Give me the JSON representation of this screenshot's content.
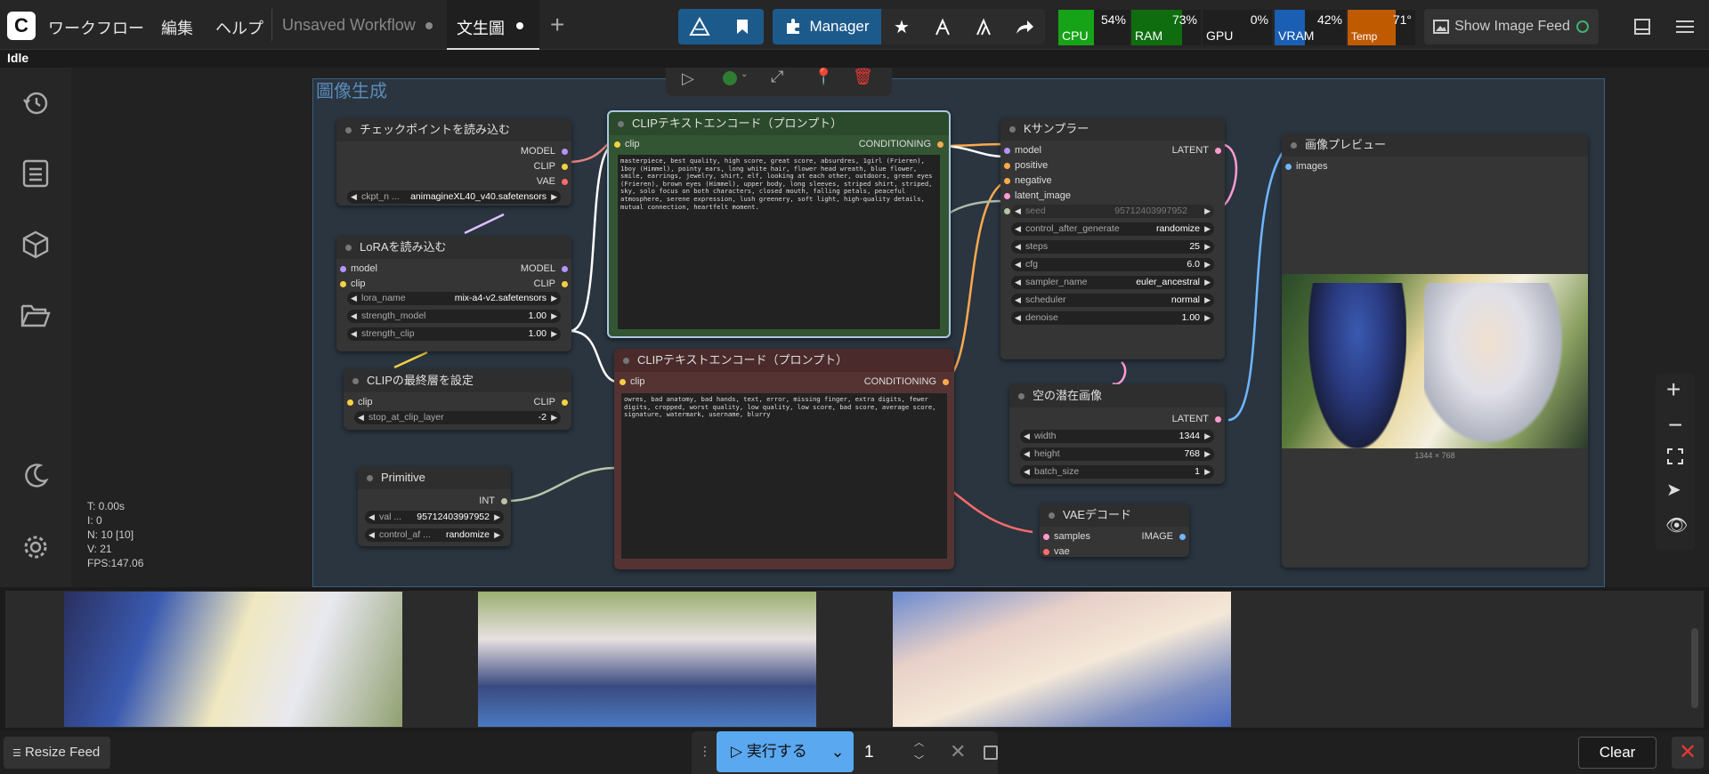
{
  "topbar": {
    "menus": [
      "ワークフロー",
      "編集",
      "ヘルプ"
    ],
    "tabs": [
      {
        "label": "Unsaved Workflow",
        "active": false
      },
      {
        "label": "文生圖",
        "active": true
      }
    ],
    "manager_label": "Manager",
    "stats": [
      {
        "label": "CPU",
        "value": "54%",
        "color": "#17a317"
      },
      {
        "label": "RAM",
        "value": "73%",
        "color": "#0f6d0f"
      },
      {
        "label": "GPU",
        "value": "0%",
        "color": "#1f1f1f"
      },
      {
        "label": "VRAM",
        "value": "42%",
        "color": "#1a5fb4"
      },
      {
        "label": "Temp",
        "value": "71°",
        "color": "#c05a00"
      }
    ],
    "show_image_feed": "Show Image Feed"
  },
  "status": "Idle",
  "group_title": "圖像生成",
  "nodes": {
    "checkpoint": {
      "title": "チェックポイントを読み込む",
      "outputs": [
        "MODEL",
        "CLIP",
        "VAE"
      ],
      "widget_label": "ckpt_n ...",
      "widget_value": "animagineXL40_v40.safetensors"
    },
    "lora": {
      "title": "LoRAを読み込む",
      "inputs": [
        "model",
        "clip"
      ],
      "outputs": [
        "MODEL",
        "CLIP"
      ],
      "widgets": [
        {
          "label": "lora_name",
          "value": "mix-a4-v2.safetensors"
        },
        {
          "label": "strength_model",
          "value": "1.00"
        },
        {
          "label": "strength_clip",
          "value": "1.00"
        }
      ]
    },
    "clipskip": {
      "title": "CLIPの最終層を設定",
      "input": "clip",
      "output": "CLIP",
      "widget_label": "stop_at_clip_layer",
      "widget_value": "-2"
    },
    "primitive": {
      "title": "Primitive",
      "output": "INT",
      "widgets": [
        {
          "label": "val ...",
          "value": "95712403997952"
        },
        {
          "label": "control_af ...",
          "value": "randomize"
        }
      ]
    },
    "clip_pos": {
      "title": "CLIPテキストエンコード（プロンプト）",
      "input": "clip",
      "output": "CONDITIONING",
      "text": "masterpiece, best quality, high score, great score, absurdres, 1girl (Frieren), 1boy (Himmel), pointy ears, long white hair, flower head wreath, blue flower, smile, earrings, jewelry, shirt, elf, looking at each other, outdoors, green eyes (Frieren), brown eyes (Himmel), upper body, long sleeves, striped shirt, striped, sky, solo focus on both characters, closed mouth, falling petals, peaceful atmosphere, serene expression, lush greenery, soft light, high-quality details, mutual connection, heartfelt moment."
    },
    "clip_neg": {
      "title": "CLIPテキストエンコード（プロンプト）",
      "input": "clip",
      "output": "CONDITIONING",
      "text": "owres, bad anatomy, bad hands, text, error, missing finger, extra digits, fewer digits, cropped, worst quality, low quality, low score, bad score, average score, signature, watermark, username, blurry"
    },
    "ksampler": {
      "title": "Kサンプラー",
      "inputs": [
        "model",
        "positive",
        "negative",
        "latent_image"
      ],
      "output": "LATENT",
      "seed_label": "seed",
      "seed_value": "95712403997952",
      "widgets": [
        {
          "label": "control_after_generate",
          "value": "randomize"
        },
        {
          "label": "steps",
          "value": "25"
        },
        {
          "label": "cfg",
          "value": "6.0"
        },
        {
          "label": "sampler_name",
          "value": "euler_ancestral"
        },
        {
          "label": "scheduler",
          "value": "normal"
        },
        {
          "label": "denoise",
          "value": "1.00"
        }
      ]
    },
    "latent": {
      "title": "空の潜在画像",
      "output": "LATENT",
      "widgets": [
        {
          "label": "width",
          "value": "1344"
        },
        {
          "label": "height",
          "value": "768"
        },
        {
          "label": "batch_size",
          "value": "1"
        }
      ]
    },
    "vaedecode": {
      "title": "VAEデコード",
      "inputs": [
        "samples",
        "vae"
      ],
      "output": "IMAGE"
    },
    "preview": {
      "title": "画像プレビュー",
      "input": "images",
      "caption": "1344 × 768"
    }
  },
  "canvas_stats": [
    "T: 0.00s",
    "I: 0",
    "N: 10 [10]",
    "V: 21",
    "FPS:147.06"
  ],
  "bottombar": {
    "resize_feed": "Resize Feed",
    "run_label": "実行する",
    "batch_count": "1",
    "clear": "Clear"
  }
}
